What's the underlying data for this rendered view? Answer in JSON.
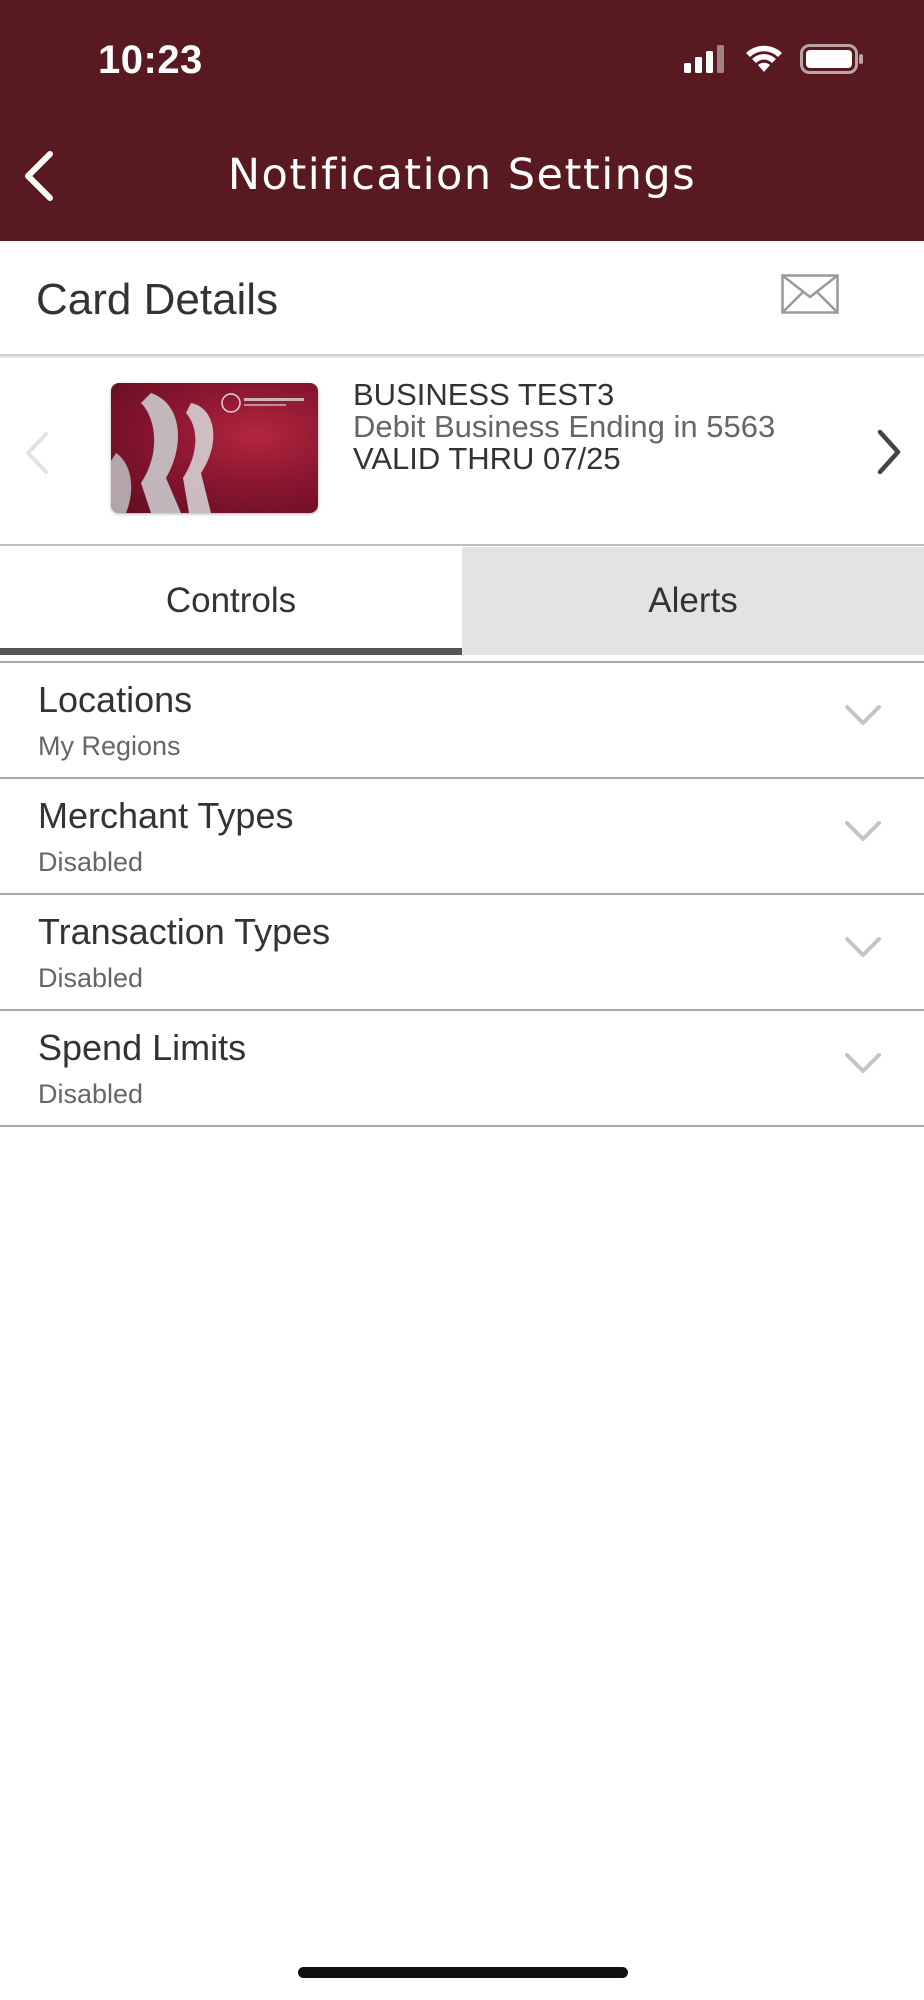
{
  "status_bar": {
    "time": "10:23",
    "icons": [
      "signal-icon",
      "wifi-icon",
      "battery-icon"
    ]
  },
  "header": {
    "title": "Notification Settings",
    "back_icon": "chevron-left-icon",
    "background_color": "#581a20"
  },
  "card_details": {
    "title": "Card Details",
    "mail_icon": "envelope-icon"
  },
  "card": {
    "name": "BUSINESS TEST3",
    "description": "Debit Business Ending in 5563",
    "valid_thru": "VALID THRU 07/25"
  },
  "tabs": [
    {
      "label": "Controls",
      "selected": true
    },
    {
      "label": "Alerts",
      "selected": false
    }
  ],
  "controls": [
    {
      "title": "Locations",
      "subtitle": "My Regions"
    },
    {
      "title": "Merchant Types",
      "subtitle": "Disabled"
    },
    {
      "title": "Transaction Types",
      "subtitle": "Disabled"
    },
    {
      "title": "Spend Limits",
      "subtitle": "Disabled"
    }
  ]
}
